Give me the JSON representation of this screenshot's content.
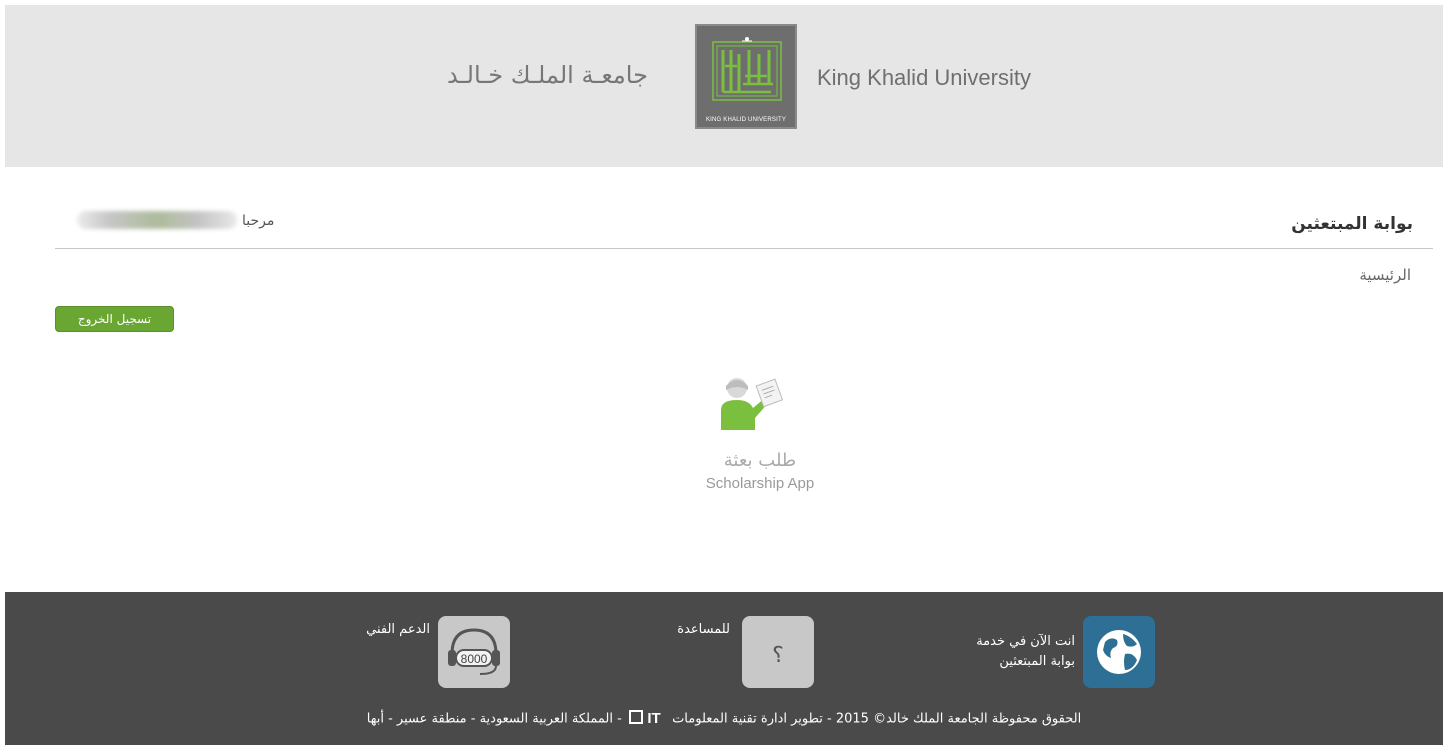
{
  "header": {
    "university_name_ar": "جامعـة الملـك خـالـد",
    "university_name_en": "King Khalid University",
    "emblem_caption": "KING KHALID UNIVERSITY",
    "emblem_glyphs": "خالد الملك جامعة"
  },
  "portal": {
    "title": "بوابة المبتعثين",
    "welcome_label": "مرحبا",
    "breadcrumb_home": "الرئيسية",
    "logout_label": "تسجيل الخروج"
  },
  "apps": [
    {
      "title_ar": "طلب بعثة",
      "title_en": "Scholarship App",
      "icon": "student-with-document-icon"
    }
  ],
  "footer": {
    "service_line1": "انت الآن في خدمة",
    "service_line2": "بوابة المبتعثين",
    "help_label": "للمساعدة",
    "help_icon_glyph": "؟",
    "support_label": "الدعم الفني",
    "support_number": "8000",
    "copyright_part1": "الحقوق محفوظة الجامعة الملك خالد© 2015 - تطوير ادارة تقنية المعلومات",
    "copyright_part2": "- المملكة العربية السعودية - منطقة عسير - أبها",
    "it_logo_text": "IT"
  },
  "colors": {
    "header_bg": "#e6e6e6",
    "footer_bg": "#4a4a4a",
    "logout_green": "#6aa632",
    "globe_blue": "#2e6f95",
    "accent_green": "#7bbf3f"
  }
}
